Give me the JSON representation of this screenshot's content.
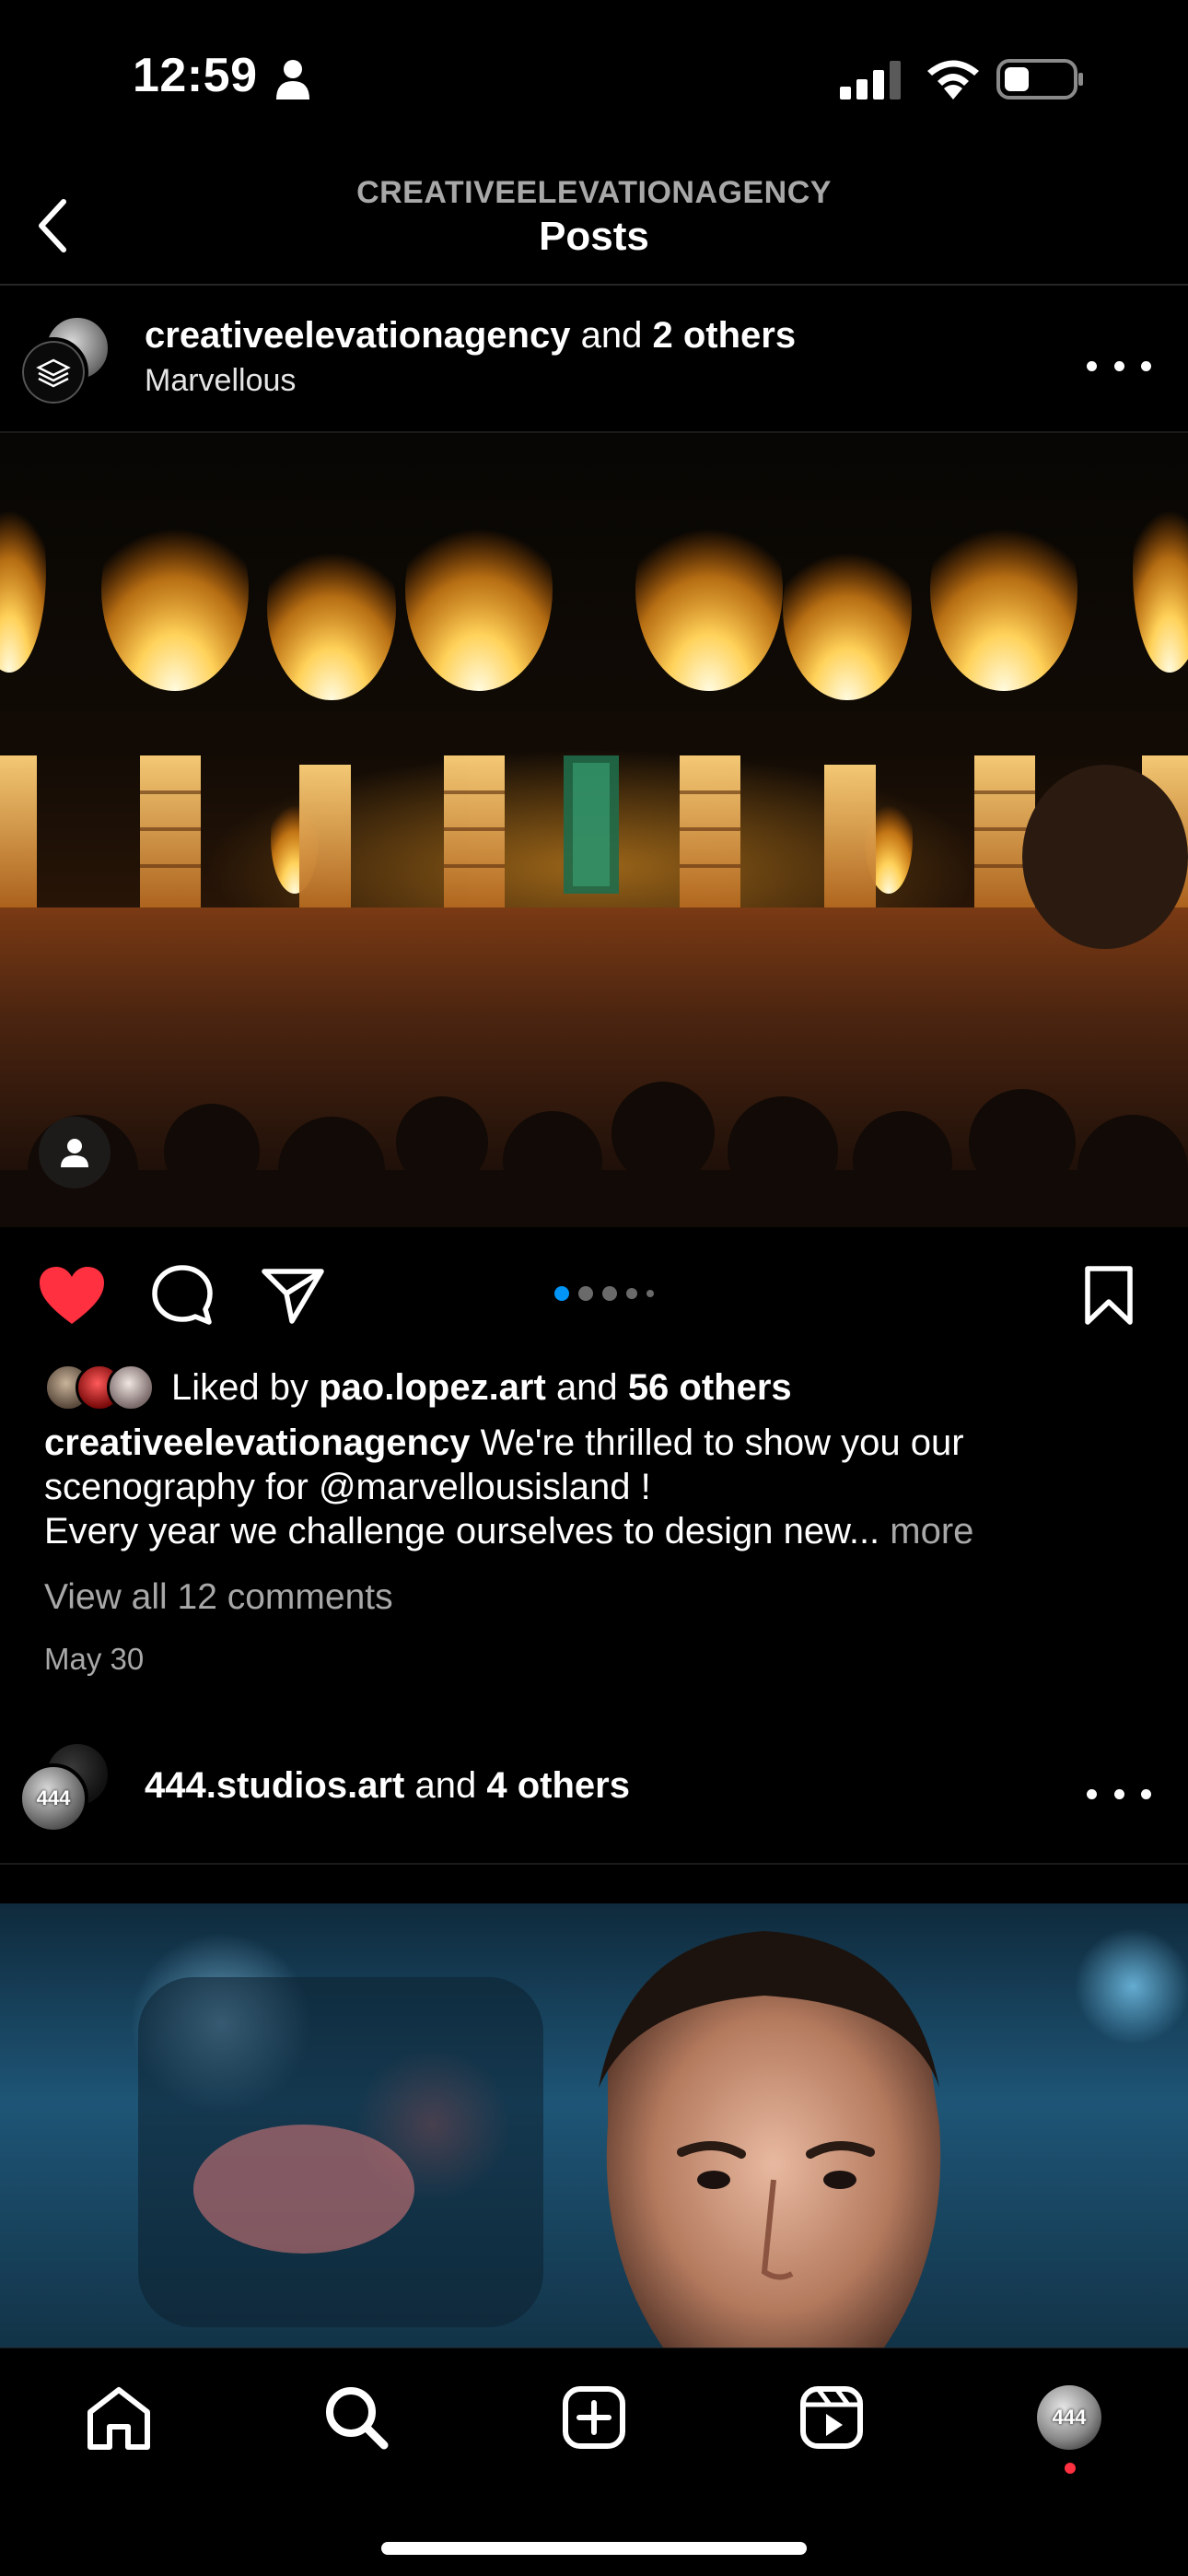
{
  "status_bar": {
    "time": "12:59"
  },
  "header": {
    "account": "CREATIVEELEVATIONAGENCY",
    "title": "Posts"
  },
  "post1": {
    "username": "creativeelevationagency",
    "collab_connector": "and",
    "collab_others": "2 others",
    "location": "Marvellous",
    "image_description_icon": "concert-stage-image",
    "carousel": {
      "count": 5,
      "active_index": 0
    },
    "liked": true,
    "likes": {
      "prefix": "Liked by",
      "user": "pao.lopez.art",
      "connector": "and",
      "others": "56 others"
    },
    "caption": {
      "username": "creativeelevationagency",
      "line1": "We're thrilled to show you our scenography for @marvellousisland !",
      "line2": "Every year we challenge ourselves to design new...",
      "more": "more"
    },
    "view_comments": "View all 12 comments",
    "date": "May 30"
  },
  "post2": {
    "username": "444.studios.art",
    "collab_connector": "and",
    "collab_others": "4 others",
    "avatar_text": "444"
  },
  "tab_bar": {
    "items": [
      "home",
      "search",
      "create",
      "reels",
      "profile"
    ],
    "profile_avatar_text": "444"
  },
  "colors": {
    "background": "#000000",
    "like_red": "#ff3040",
    "carousel_active": "#0095f6",
    "muted_text": "#a8a8a8"
  }
}
